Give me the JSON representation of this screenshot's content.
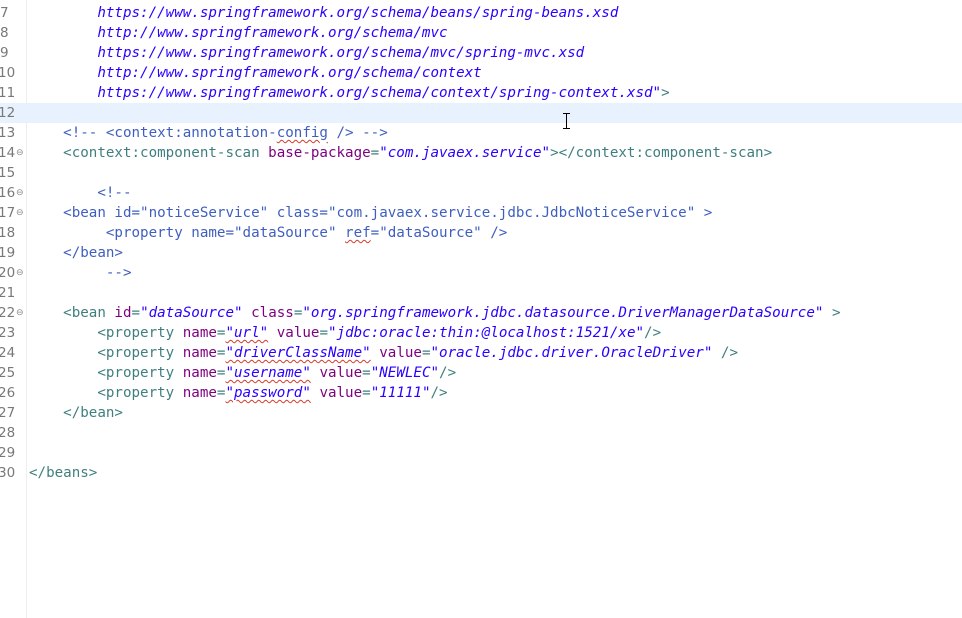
{
  "editor": {
    "lines": [
      {
        "n": "7",
        "fold": "",
        "segs": [
          [
            "url",
            "        https://www.springframework.org/schema/beans/spring-beans.xsd"
          ]
        ]
      },
      {
        "n": "8",
        "fold": "",
        "segs": [
          [
            "url",
            "        http://www.springframework.org/schema/mvc"
          ]
        ]
      },
      {
        "n": "9",
        "fold": "",
        "segs": [
          [
            "url",
            "        https://www.springframework.org/schema/mvc/spring-mvc.xsd"
          ]
        ]
      },
      {
        "n": "10",
        "fold": "",
        "segs": [
          [
            "url",
            "        http://www.springframework.org/schema/context"
          ]
        ]
      },
      {
        "n": "11",
        "fold": "",
        "segs": [
          [
            "url",
            "        https://www.springframework.org/schema/context/spring-context.xsd\""
          ],
          [
            "tag",
            ">"
          ]
        ]
      },
      {
        "n": "12",
        "fold": "",
        "current": true,
        "segs": [
          [
            "tag",
            ""
          ]
        ]
      },
      {
        "n": "13",
        "fold": "",
        "segs": [
          [
            "cmt",
            "    <!-- <context:annotation-"
          ],
          [
            "cmt sq",
            "config"
          ],
          [
            "cmt",
            " /> -->"
          ]
        ]
      },
      {
        "n": "14",
        "fold": "⊖",
        "segs": [
          [
            "tag",
            "    <context:component-scan "
          ],
          [
            "attr",
            "base-package"
          ],
          [
            "tag",
            "="
          ],
          [
            "val",
            "\"com.javaex.service\""
          ],
          [
            "tag",
            "></context:component-scan>"
          ]
        ]
      },
      {
        "n": "15",
        "fold": "",
        "segs": [
          [
            "tag",
            ""
          ]
        ]
      },
      {
        "n": "16",
        "fold": "⊖",
        "segs": [
          [
            "cmt",
            "        <!--"
          ]
        ]
      },
      {
        "n": "17",
        "fold": "⊖",
        "segs": [
          [
            "cmt",
            "    <bean id=\"noticeService\" class=\"com.javaex.service.jdbc.JdbcNoticeService\" >"
          ]
        ]
      },
      {
        "n": "18",
        "fold": "",
        "segs": [
          [
            "cmt",
            "         <property name=\"dataSource\" "
          ],
          [
            "cmt sq",
            "ref"
          ],
          [
            "cmt",
            "=\"dataSource\" />"
          ]
        ]
      },
      {
        "n": "19",
        "fold": "",
        "segs": [
          [
            "cmt",
            "    </bean>"
          ]
        ]
      },
      {
        "n": "20",
        "fold": "⊖",
        "segs": [
          [
            "cmt",
            "         -->"
          ]
        ]
      },
      {
        "n": "21",
        "fold": "",
        "segs": [
          [
            "tag",
            ""
          ]
        ]
      },
      {
        "n": "22",
        "fold": "⊖",
        "segs": [
          [
            "tag",
            "    <bean "
          ],
          [
            "attr",
            "id"
          ],
          [
            "tag",
            "="
          ],
          [
            "val",
            "\"dataSource\""
          ],
          [
            "tag",
            " "
          ],
          [
            "attr",
            "class"
          ],
          [
            "tag",
            "="
          ],
          [
            "val",
            "\"org.springframework.jdbc.datasource.DriverManagerDataSource\""
          ],
          [
            "tag",
            " >"
          ]
        ]
      },
      {
        "n": "23",
        "fold": "",
        "segs": [
          [
            "tag",
            "        <property "
          ],
          [
            "attr",
            "name"
          ],
          [
            "tag",
            "="
          ],
          [
            "val sq",
            "\"url\""
          ],
          [
            "tag",
            " "
          ],
          [
            "attr",
            "value"
          ],
          [
            "tag",
            "="
          ],
          [
            "val",
            "\"jdbc:oracle:thin:@localhost:1521/xe\""
          ],
          [
            "tag",
            "/>"
          ]
        ]
      },
      {
        "n": "24",
        "fold": "",
        "segs": [
          [
            "tag",
            "        <property "
          ],
          [
            "attr",
            "name"
          ],
          [
            "tag",
            "="
          ],
          [
            "val sq",
            "\"driverClassName\""
          ],
          [
            "tag",
            " "
          ],
          [
            "attr",
            "value"
          ],
          [
            "tag",
            "="
          ],
          [
            "val",
            "\"oracle.jdbc.driver.OracleDriver\""
          ],
          [
            "tag",
            " />"
          ]
        ]
      },
      {
        "n": "25",
        "fold": "",
        "segs": [
          [
            "tag",
            "        <property "
          ],
          [
            "attr",
            "name"
          ],
          [
            "tag",
            "="
          ],
          [
            "val sq",
            "\"username\""
          ],
          [
            "tag",
            " "
          ],
          [
            "attr",
            "value"
          ],
          [
            "tag",
            "="
          ],
          [
            "val",
            "\"NEWLEC\""
          ],
          [
            "tag",
            "/>"
          ]
        ]
      },
      {
        "n": "26",
        "fold": "",
        "segs": [
          [
            "tag",
            "        <property "
          ],
          [
            "attr",
            "name"
          ],
          [
            "tag",
            "="
          ],
          [
            "val sq",
            "\"password\""
          ],
          [
            "tag",
            " "
          ],
          [
            "attr",
            "value"
          ],
          [
            "tag",
            "="
          ],
          [
            "val",
            "\"11111\""
          ],
          [
            "tag",
            "/>"
          ]
        ]
      },
      {
        "n": "27",
        "fold": "",
        "segs": [
          [
            "tag",
            "    </bean>"
          ]
        ]
      },
      {
        "n": "28",
        "fold": "",
        "segs": [
          [
            "tag",
            ""
          ]
        ]
      },
      {
        "n": "29",
        "fold": "",
        "segs": [
          [
            "tag",
            ""
          ]
        ]
      },
      {
        "n": "30",
        "fold": "",
        "segs": [
          [
            "tag",
            "</beans>"
          ]
        ]
      }
    ]
  },
  "colors": {
    "tag": "#3f7f7f",
    "attribute": "#7f007f",
    "value": "#2a00ff",
    "comment": "#3f5fbf",
    "current_line": "#e8f2fe",
    "line_number": "#787878"
  },
  "icons": {
    "fold_marker": "collapse-minus-icon",
    "cursor": "i-beam-cursor-icon"
  }
}
